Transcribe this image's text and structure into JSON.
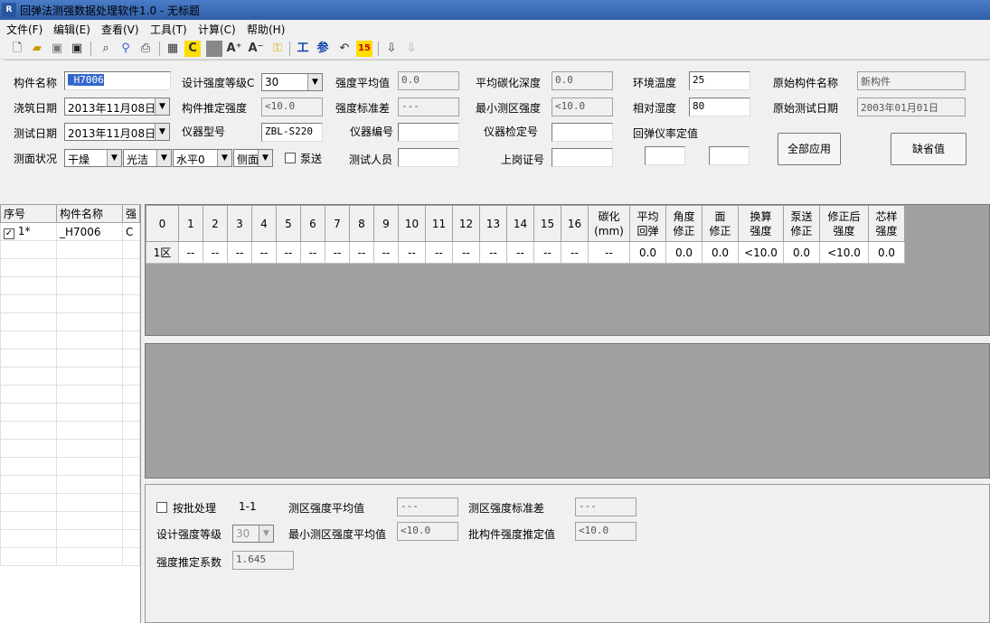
{
  "window": {
    "title": "回弹法测强数据处理软件1.0 - 无标题",
    "icon": "app-icon"
  },
  "menu": [
    "文件(F)",
    "编辑(E)",
    "查看(V)",
    "工具(T)",
    "计算(C)",
    "帮助(H)"
  ],
  "form": {
    "lbl_name": "构件名称",
    "name": "_H7006",
    "lbl_design_grade": "设计强度等级C",
    "design_grade": "30",
    "lbl_avg": "强度平均值",
    "avg": "0.0",
    "lbl_avg_carb": "平均碳化深度",
    "avg_carb": "0.0",
    "lbl_temp": "环境温度",
    "temp": "25",
    "lbl_orig_name": "原始构件名称",
    "orig_name": "新构件",
    "lbl_cast_date": "浇筑日期",
    "cast_date": "2013年11月08日",
    "lbl_est": "构件推定强度",
    "est": "<10.0",
    "lbl_std": "强度标准差",
    "std": "---",
    "lbl_min": "最小测区强度",
    "min": "<10.0",
    "lbl_humid": "相对湿度",
    "humid": "80",
    "lbl_orig_date": "原始测试日期",
    "orig_date": "2003年01月01日",
    "lbl_test_date": "测试日期",
    "test_date": "2013年11月08日",
    "lbl_inst_model": "仪器型号",
    "inst_model": "ZBL-S220",
    "lbl_inst_no": "仪器编号",
    "inst_no": "",
    "lbl_inst_cert": "仪器检定号",
    "inst_cert": "",
    "lbl_rate": "回弹仪率定值",
    "lbl_surface": "测面状况",
    "surf1": "干燥",
    "surf2": "光洁",
    "surf3": "水平0",
    "surf4": "侧面",
    "lbl_pump": "泵送",
    "lbl_tester": "测试人员",
    "tester": "",
    "lbl_post_cert": "上岗证号",
    "post_cert": "",
    "btn_apply": "全部应用",
    "btn_default": "缺省值"
  },
  "list": {
    "headers": [
      "序号",
      "构件名称",
      "强"
    ],
    "rows": [
      {
        "no": "1*",
        "name": "_H7006",
        "c": "C"
      }
    ]
  },
  "grid": {
    "headers": [
      "0",
      "1",
      "2",
      "3",
      "4",
      "5",
      "6",
      "7",
      "8",
      "9",
      "10",
      "11",
      "12",
      "13",
      "14",
      "15",
      "16",
      "碳化\n(mm)",
      "平均\n回弹",
      "角度\n修正",
      "面\n修正",
      "换算\n强度",
      "泵送\n修正",
      "修正后\n强度",
      "芯样\n强度"
    ],
    "rows": [
      [
        "1区",
        "--",
        "--",
        "--",
        "--",
        "--",
        "--",
        "--",
        "--",
        "--",
        "--",
        "--",
        "--",
        "--",
        "--",
        "--",
        "--",
        "--",
        "0.0",
        "0.0",
        "0.0",
        "<10.0",
        "0.0",
        "<10.0",
        "0.0"
      ]
    ]
  },
  "bottom": {
    "lbl_batch": "按批处理",
    "batch_range": "1-1",
    "lbl_area_avg": "测区强度平均值",
    "area_avg": "---",
    "lbl_area_std": "测区强度标准差",
    "area_std": "---",
    "lbl_grade": "设计强度等级",
    "grade": "30",
    "lbl_min_avg": "最小测区强度平均值",
    "min_avg": "<10.0",
    "lbl_batch_est": "批构件强度推定值",
    "batch_est": "<10.0",
    "lbl_coef": "强度推定系数",
    "coef": "1.645"
  }
}
